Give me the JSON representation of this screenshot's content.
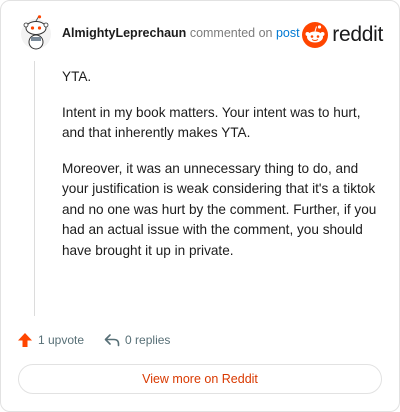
{
  "comment": {
    "author": "AlmightyLeprechaun",
    "action_text": "commented on",
    "target_link": "post",
    "paragraphs": [
      "YTA.",
      "Intent in my book matters. Your intent was to hurt, and that inherently makes YTA.",
      "Moreover, it was an unnecessary thing to do, and your justification is weak considering that it's a tiktok and no one was hurt by the comment. Further, if you had an actual issue with the comment, you should have brought it up in private."
    ]
  },
  "brand": {
    "wordmark": "reddit",
    "icon": "reddit-logo-icon",
    "color": "#ff4500"
  },
  "footer": {
    "upvotes_label": "1 upvote",
    "replies_label": "0 replies",
    "view_more_label": "View more on Reddit"
  },
  "colors": {
    "accent": "#ff4500",
    "link": "#0079d3",
    "muted": "#576f76"
  }
}
